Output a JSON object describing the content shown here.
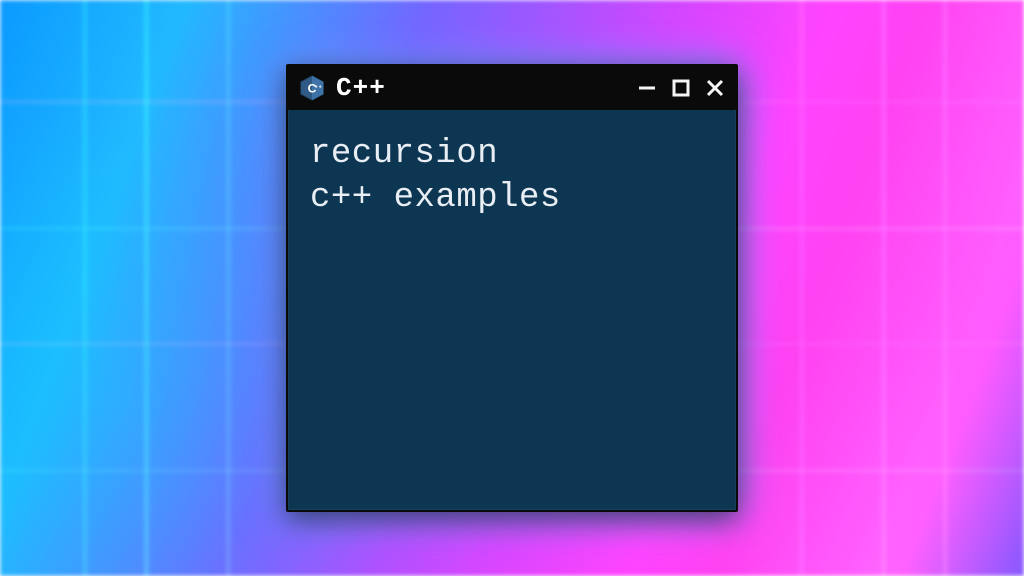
{
  "window": {
    "title": "C++",
    "icon_name": "cpp-icon"
  },
  "content": {
    "line1": "recursion",
    "line2": "c++ examples"
  },
  "colors": {
    "terminal_bg": "#0d3652",
    "titlebar_bg": "#0a0a0a",
    "text": "#e8eef4"
  }
}
